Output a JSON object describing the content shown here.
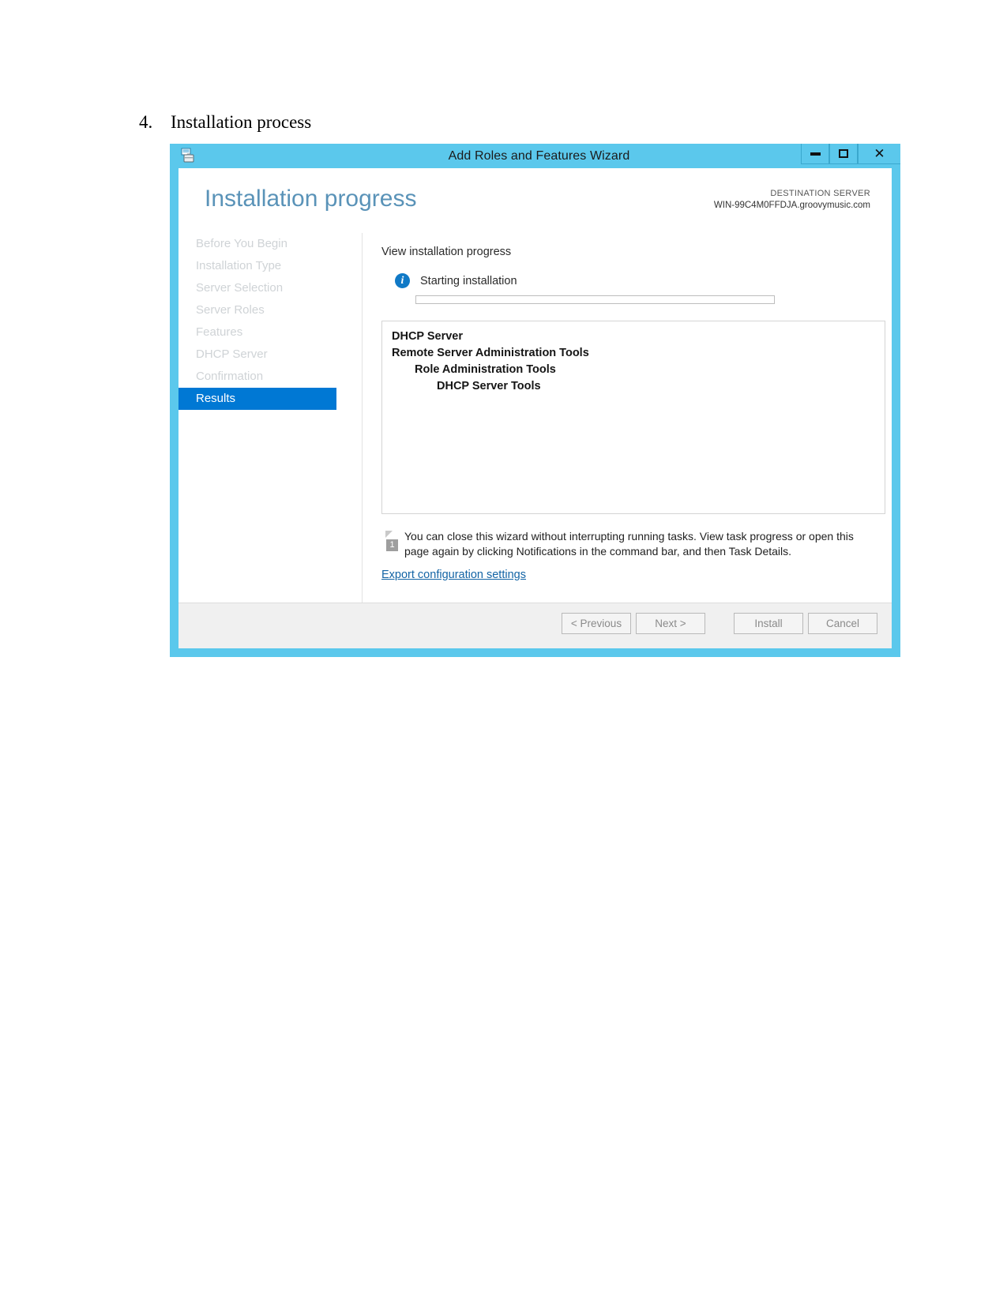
{
  "document": {
    "list_number": "4.",
    "heading": "Installation process"
  },
  "window": {
    "title": "Add Roles and Features Wizard",
    "app_icon": "wizard-icon",
    "controls": {
      "minimize": "–",
      "maximize": "□",
      "close": "✕"
    },
    "accent_color": "#5BC8EC"
  },
  "header": {
    "page_title": "Installation progress",
    "destination_label": "DESTINATION SERVER",
    "destination_server": "WIN-99C4M0FFDJA.groovymusic.com"
  },
  "sidebar": {
    "items": [
      {
        "label": "Before You Begin",
        "active": false
      },
      {
        "label": "Installation Type",
        "active": false
      },
      {
        "label": "Server Selection",
        "active": false
      },
      {
        "label": "Server Roles",
        "active": false
      },
      {
        "label": "Features",
        "active": false
      },
      {
        "label": "DHCP Server",
        "active": false
      },
      {
        "label": "Confirmation",
        "active": false
      },
      {
        "label": "Results",
        "active": true
      }
    ],
    "active_color": "#0078D4"
  },
  "main": {
    "section_label": "View installation progress",
    "status": {
      "icon": "info-icon",
      "text": "Starting installation",
      "progress_percent": 0
    },
    "results": [
      {
        "text": "DHCP Server",
        "level": 1
      },
      {
        "text": "Remote Server Administration Tools",
        "level": 1
      },
      {
        "text": "Role Administration Tools",
        "level": 2
      },
      {
        "text": "DHCP Server Tools",
        "level": 3
      }
    ],
    "notice": {
      "icon": "notification-badge-icon",
      "badge": "1",
      "text": "You can close this wizard without interrupting running tasks. View task progress or open this page again by clicking Notifications in the command bar, and then Task Details."
    },
    "export_link": "Export configuration settings"
  },
  "footer": {
    "buttons": [
      {
        "label": "< Previous",
        "name": "previous-button",
        "disabled": true
      },
      {
        "label": "Next >",
        "name": "next-button",
        "disabled": true
      },
      {
        "label": "Install",
        "name": "install-button",
        "disabled": true
      },
      {
        "label": "Cancel",
        "name": "cancel-button",
        "disabled": false
      }
    ]
  }
}
